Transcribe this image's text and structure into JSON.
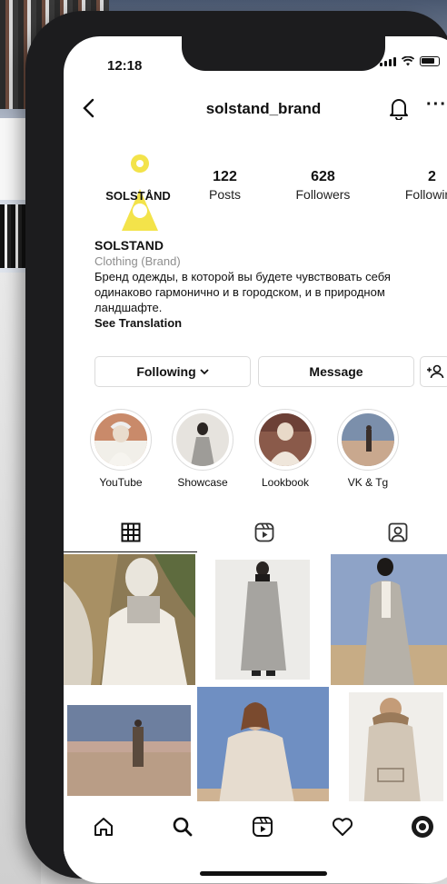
{
  "status_bar": {
    "time": "12:18"
  },
  "header": {
    "username": "solstand_brand",
    "back_icon": "chevron-left-icon",
    "bell_icon": "bell-icon",
    "more_icon": "more-horizontal-icon",
    "more_text": "···"
  },
  "profile": {
    "logo_text": "SOLSTÅND",
    "brand_color": "#f3e34a",
    "stats": [
      {
        "value": "122",
        "label": "Posts"
      },
      {
        "value": "628",
        "label": "Followers"
      },
      {
        "value": "2",
        "label": "Following"
      }
    ],
    "name": "SOLSTAND",
    "category": "Clothing (Brand)",
    "bio": "Бренд одежды, в которой вы будете чувствовать себя одинаково гармонично и в городском, и в природном ландшафте.",
    "see_translation": "See Translation"
  },
  "actions": {
    "following": "Following",
    "message": "Message",
    "add_user_icon": "add-person-icon"
  },
  "highlights": [
    {
      "label": "YouTube"
    },
    {
      "label": "Showcase"
    },
    {
      "label": "Lookbook"
    },
    {
      "label": "VK & Tg"
    }
  ],
  "tabs": [
    {
      "name": "grid-tab",
      "icon": "grid-icon",
      "active": true
    },
    {
      "name": "reels-tab",
      "icon": "reels-icon",
      "active": false
    },
    {
      "name": "tagged-tab",
      "icon": "tagged-person-icon",
      "active": false
    }
  ],
  "bottom_nav": [
    {
      "name": "home",
      "icon": "home-icon"
    },
    {
      "name": "search",
      "icon": "search-icon"
    },
    {
      "name": "reels",
      "icon": "reels-icon"
    },
    {
      "name": "activity",
      "icon": "heart-icon"
    },
    {
      "name": "profile",
      "icon": "profile-avatar-icon"
    }
  ]
}
